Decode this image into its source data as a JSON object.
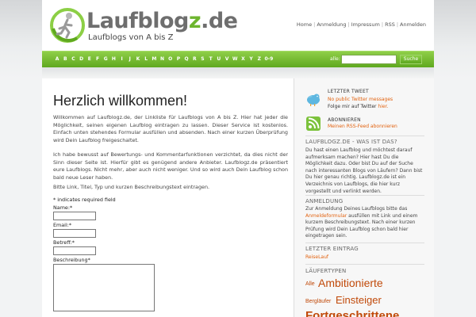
{
  "header": {
    "brand_main": "Laufblog",
    "brand_z": "z",
    "brand_tld": ".de",
    "tagline": "Laufblogs von A bis Z",
    "nav": [
      "Home",
      "Anmeldung",
      "Impressum",
      "RSS",
      "Anmelden"
    ]
  },
  "alphabet": {
    "letters": [
      "A",
      "B",
      "C",
      "D",
      "E",
      "F",
      "G",
      "H",
      "I",
      "J",
      "K",
      "L",
      "M",
      "N",
      "O",
      "P",
      "Q",
      "R",
      "S",
      "T",
      "U",
      "V",
      "W",
      "X",
      "Y",
      "Z",
      "0-9"
    ],
    "alle": "alle:",
    "search_button": "Suche"
  },
  "main": {
    "title": "Herzlich willkommen!",
    "intro": "Willkommen auf Laufblogz.de, der Linkliste für Laufblogs von A bis Z. Hier hat jeder die Möglichkeit, seinen eigenen Laufblog eintragen zu lassen. Dieser Service ist kostenlos. Einfach unten stehendes Formular ausfüllen und absenden. Nach einer kurzen Überprüfung wird Dein Laufblog freigeschaltet.",
    "para2": "Ich habe bewusst auf Bewertungs- und Kommentarfunktionen verzichtet, da dies nicht der Sinn dieser Seite ist. Hierfür gibt es genügend andere Anbieter. Laufblogz.de präsentiert eure Laufblogs. Nicht mehr, aber auch nicht weniger. Und so wird auch Dein Laufblog schon bald neue Leser haben.",
    "para3": "Bitte Link, Titel, Typ und kurzen Beschreibungstext eintragen.",
    "required_note": "* indicates required field",
    "fields": {
      "name": "Name:*",
      "email": "Email:*",
      "subject": "Betreff:*",
      "description": "Beschreibung*"
    }
  },
  "sidebar": {
    "tweet_title": "LETZTER TWEET",
    "tweet_text": "No public Twitter messages",
    "twitter_follow": "Folge mir auf Twitter",
    "twitter_link": "hier.",
    "subscribe_title": "ABONNIEREN",
    "subscribe_link": "Meinen RSS-Feed abonnieren",
    "about_title": "LAUFBLOGZ.DE - WAS IST DAS?",
    "about_text": "Du hast einen Laufblog und möchtest darauf aufmerksam machen? Hier hast Du die Möglichkeit dazu. Oder bist Du auf der Suche nach interessanten Blogs von Läufern? Dann bist Du hier genau richtig. Laufblogz.de ist ein Verzeichnis von Laufblogs, die hier kurz vorgestellt und verlinkt werden.",
    "signup_title": "ANMELDUNG",
    "signup_pre": "Zur Anmeldung Deines Laufblogs bitte das",
    "signup_link": "Anmeldeformular",
    "signup_post": "ausfüllen mit Link und einem kurzem Beschreibungstext. Nach einer kurzen Prüfung wird Dein Laufblog schon bald hier eingetragen sein.",
    "last_title": "LETZTER EINTRAG",
    "last_link": "ReiseLauf",
    "types_title": "LÄUFERTYPEN",
    "tags": [
      "Alle",
      "Ambitionierte",
      "Bergläufer",
      "Einsteiger",
      "Fortgeschrittene"
    ]
  },
  "colors": {
    "brand_green": "#6db52e",
    "link_orange": "#e2620f",
    "tag_orange": "#c14a0a"
  }
}
